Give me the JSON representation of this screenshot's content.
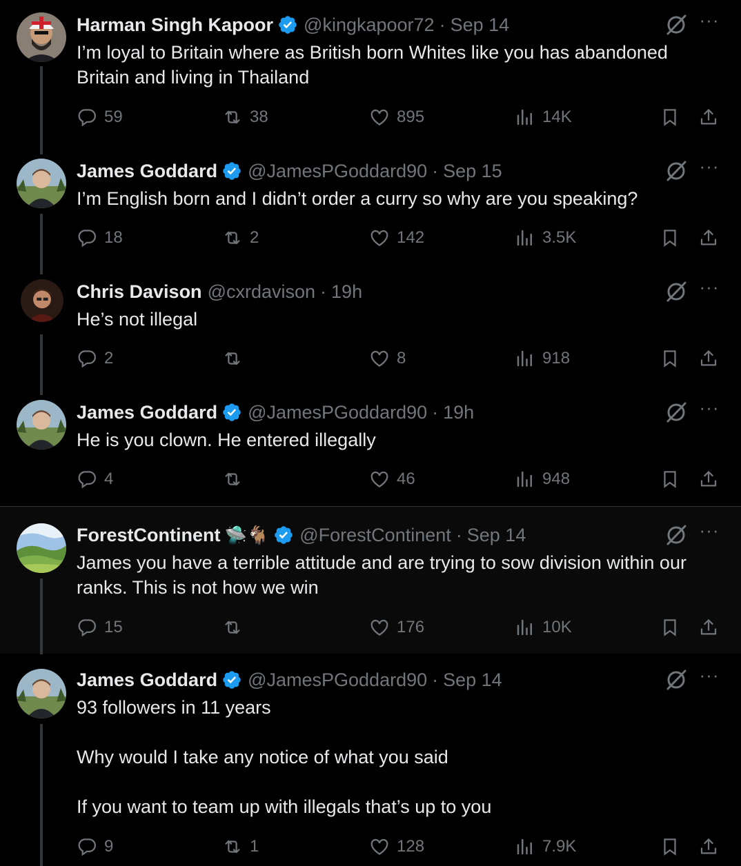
{
  "tweets": [
    {
      "name": "Harman Singh Kapoor",
      "verified": true,
      "emoji": "",
      "handle": "@kingkapoor72",
      "sep": "·",
      "time": "Sep 14",
      "text": "I’m loyal to Britain where as British born Whites like you has abandoned Britain and living in Thailand",
      "replies": "59",
      "reposts": "38",
      "likes": "895",
      "views": "14K"
    },
    {
      "name": "James Goddard",
      "verified": true,
      "emoji": "",
      "handle": "@JamesPGoddard90",
      "sep": "·",
      "time": "Sep 15",
      "text": "I’m English born and I didn’t order a curry so why are you speaking?",
      "replies": "18",
      "reposts": "2",
      "likes": "142",
      "views": "3.5K"
    },
    {
      "name": "Chris Davison",
      "verified": false,
      "emoji": "",
      "handle": "@cxrdavison",
      "sep": "·",
      "time": "19h",
      "text": "He’s not illegal",
      "replies": "2",
      "reposts": "",
      "likes": "8",
      "views": "918"
    },
    {
      "name": "James Goddard",
      "verified": true,
      "emoji": "",
      "handle": "@JamesPGoddard90",
      "sep": "·",
      "time": "19h",
      "text": "He is you clown. He entered illegally",
      "replies": "4",
      "reposts": "",
      "likes": "46",
      "views": "948"
    },
    {
      "name": "ForestContinent",
      "verified": true,
      "emoji": "🛸🐐",
      "handle": "@ForestContinent",
      "sep": "·",
      "time": "Sep 14",
      "text": "James you have a terrible attitude and are trying to sow division within our ranks. This is not how we win",
      "replies": "15",
      "reposts": "",
      "likes": "176",
      "views": "10K"
    },
    {
      "name": "James Goddard",
      "verified": true,
      "emoji": "",
      "handle": "@JamesPGoddard90",
      "sep": "·",
      "time": "Sep 14",
      "text": "93 followers in 11 years\n\nWhy would I take any notice of what you said\n\nIf you want to team up with illegals that’s up to you",
      "replies": "9",
      "reposts": "1",
      "likes": "128",
      "views": "7.9K"
    }
  ],
  "more_label": "···",
  "colors": {
    "background": "#000000",
    "text": "#e7e9ea",
    "muted": "#71767b",
    "verified": "#1d9bf0",
    "thread_line": "#333639",
    "highlight_bg": "#0a0a0a"
  },
  "icons": [
    "verified-badge-icon",
    "grok-icon",
    "more-icon",
    "reply-icon",
    "repost-icon",
    "like-icon",
    "views-icon",
    "bookmark-icon",
    "share-icon"
  ]
}
